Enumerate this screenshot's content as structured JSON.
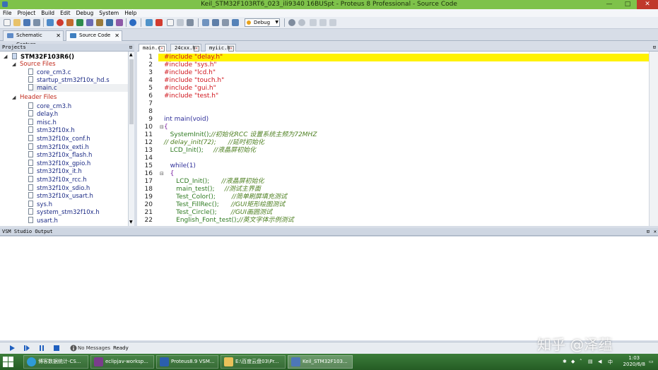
{
  "window": {
    "title": "Keil_STM32F103RT6_023_ili9340 16BUSpt - Proteus 8 Professional - Source Code",
    "controls": {
      "minimize": "—",
      "maximize": "□",
      "close": "✕"
    }
  },
  "menu": [
    "File",
    "Project",
    "Build",
    "Edit",
    "Debug",
    "System",
    "Help"
  ],
  "toolbar": {
    "build_config": "Debug"
  },
  "doc_tabs": [
    {
      "label": "Schematic Capture",
      "close": "✕"
    },
    {
      "label": "Source Code",
      "close": "✕"
    }
  ],
  "projects_pane": {
    "title": "Projects",
    "pin": "⊡",
    "root": "STM32F103R6()",
    "groups": [
      {
        "name": "Source Files",
        "files": [
          "core_cm3.c",
          "startup_stm32f10x_hd.s",
          "main.c"
        ]
      },
      {
        "name": "Header Files",
        "files": [
          "core_cm3.h",
          "delay.h",
          "misc.h",
          "stm32f10x.h",
          "stm32f10x_conf.h",
          "stm32f10x_exti.h",
          "stm32f10x_flash.h",
          "stm32f10x_gpio.h",
          "stm32f10x_it.h",
          "stm32f10x_rcc.h",
          "stm32f10x_sdio.h",
          "stm32f10x_usart.h",
          "sys.h",
          "system_stm32f10x.h",
          "usart.h"
        ]
      }
    ]
  },
  "code_tabs": [
    {
      "label": "main.c",
      "close": "✕"
    },
    {
      "label": "24cxx.h",
      "close": "✕"
    },
    {
      "label": "myiic.h",
      "close": "✕"
    }
  ],
  "code": {
    "line_numbers": [
      "1",
      "2",
      "3",
      "4",
      "5",
      "6",
      "7",
      "8",
      "9",
      "10",
      "11",
      "12",
      "13",
      "14",
      "15",
      "16",
      "17",
      "18",
      "19",
      "20",
      "21",
      "22"
    ],
    "lines": [
      {
        "segments": [
          {
            "t": "#include \"delay.h\"",
            "c": "pp"
          }
        ]
      },
      {
        "segments": [
          {
            "t": "#include \"sys.h\"",
            "c": "pp"
          }
        ]
      },
      {
        "segments": [
          {
            "t": "#include \"lcd.h\"",
            "c": "pp"
          }
        ]
      },
      {
        "segments": [
          {
            "t": "#include \"touch.h\"",
            "c": "pp"
          }
        ]
      },
      {
        "segments": [
          {
            "t": "#include \"gui.h\"",
            "c": "pp"
          }
        ]
      },
      {
        "segments": [
          {
            "t": "#include \"test.h\"",
            "c": "pp"
          }
        ]
      },
      {
        "segments": []
      },
      {
        "segments": []
      },
      {
        "segments": [
          {
            "t": "int main(void)",
            "c": "kw"
          }
        ]
      },
      {
        "segments": [
          {
            "t": "{",
            "c": "br"
          }
        ]
      },
      {
        "segments": [
          {
            "t": "   SystemInit();",
            "c": "fn"
          },
          {
            "t": "//初始化RCC 设置系统主频为72MHZ",
            "c": "cm"
          }
        ]
      },
      {
        "segments": [
          {
            "t": "// delay_init(72);      //延时初始化",
            "c": "cm"
          }
        ]
      },
      {
        "segments": [
          {
            "t": "   LCD_Init();     ",
            "c": "fn"
          },
          {
            "t": "//液晶屏初始化",
            "c": "cm"
          }
        ]
      },
      {
        "segments": []
      },
      {
        "segments": [
          {
            "t": "   while(1)",
            "c": "kw"
          }
        ]
      },
      {
        "segments": [
          {
            "t": "   {",
            "c": "br"
          }
        ]
      },
      {
        "segments": [
          {
            "t": "      LCD_Init();      ",
            "c": "fn"
          },
          {
            "t": "//液晶屏初始化",
            "c": "cm"
          }
        ]
      },
      {
        "segments": [
          {
            "t": "      main_test();     ",
            "c": "fn"
          },
          {
            "t": "//测试主界面",
            "c": "cm"
          }
        ]
      },
      {
        "segments": [
          {
            "t": "      Test_Color();        ",
            "c": "fn"
          },
          {
            "t": "//简单刷屏填充测试",
            "c": "cm"
          }
        ]
      },
      {
        "segments": [
          {
            "t": "      Test_FillRec();      ",
            "c": "fn"
          },
          {
            "t": "//GUI矩形绘图测试",
            "c": "cm"
          }
        ]
      },
      {
        "segments": [
          {
            "t": "      Test_Circle();       ",
            "c": "fn"
          },
          {
            "t": "//GUI画圆测试",
            "c": "cm"
          }
        ]
      },
      {
        "segments": [
          {
            "t": "      English_Font_test();",
            "c": "fn"
          },
          {
            "t": "//英文字体示例测试",
            "c": "cm"
          }
        ]
      }
    ],
    "fold_markers": [
      "⊟",
      "⊟"
    ]
  },
  "output_pane": {
    "title": "VSM Studio Output",
    "pin": "⊡",
    "close": "✕"
  },
  "status": {
    "messages": "No Messages",
    "state": "Ready"
  },
  "taskbar": {
    "tasks": [
      "博客数据统计-CS...",
      "eclipjav-worksp...",
      "Proteus8.9 VSM...",
      "E:\\百度云盘03\\Pr...",
      "Keil_STM32F103..."
    ],
    "time": "1:03",
    "date": "2020/6/8"
  },
  "watermark": "知乎 @泽蕴",
  "colors": {
    "title_bar": "#7ec24a",
    "highlight": "#fff200",
    "preprocessor": "#d0141c",
    "comment": "#4c7f1f",
    "folder": "#c12a1c",
    "file": "#1b2a85",
    "taskbar": "#2f6d2e"
  }
}
